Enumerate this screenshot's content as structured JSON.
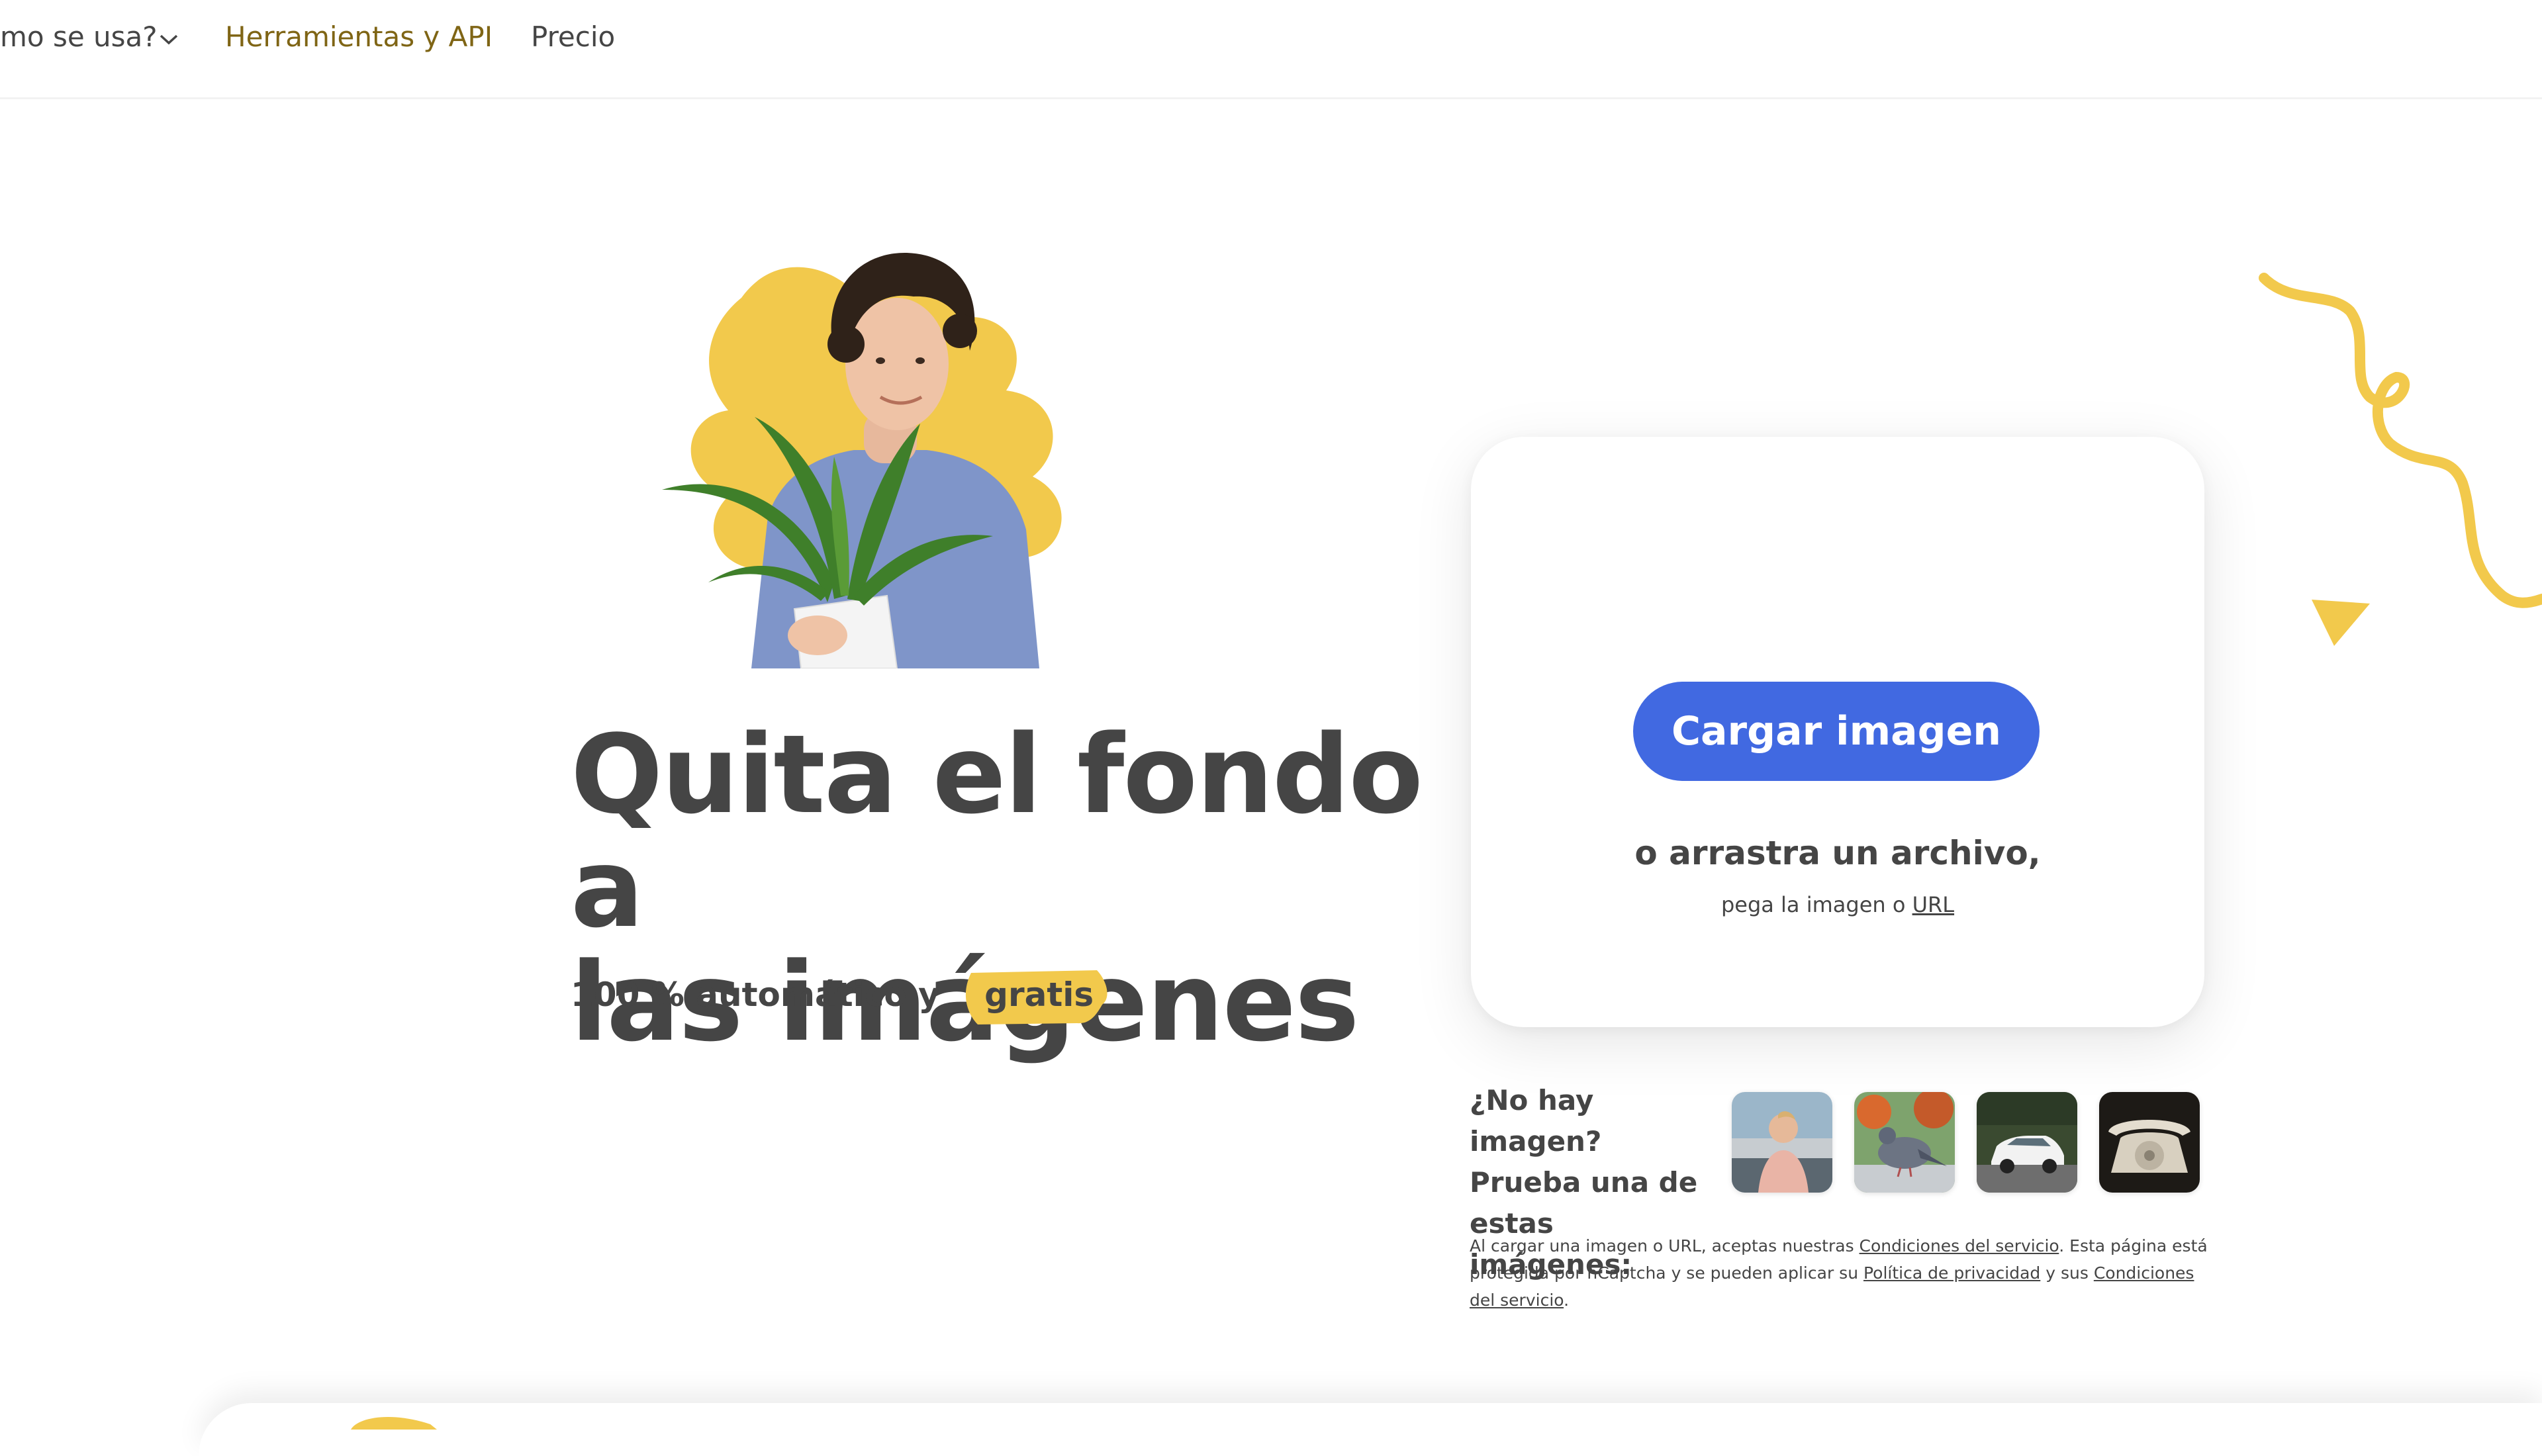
{
  "nav": {
    "how_label": "mo se usa?",
    "tools_label": "Herramientas y API",
    "price_label": "Precio"
  },
  "hero": {
    "title_line1": "Quita el fondo a",
    "title_line2": "las imágenes",
    "subtitle_prefix": "100 % automático y",
    "subtitle_highlight": "gratis"
  },
  "upload": {
    "button_label": "Cargar imagen",
    "drop_text": "o arrastra un archivo,",
    "paste_prefix": "pega la imagen o",
    "paste_link": "URL"
  },
  "samples": {
    "label_line1": "¿No hay imagen?",
    "label_line2": "Prueba una de",
    "label_line3": "estas imágenes:",
    "items": [
      {
        "icon": "person-photo"
      },
      {
        "icon": "pigeon-photo"
      },
      {
        "icon": "car-photo"
      },
      {
        "icon": "telephone-photo"
      }
    ]
  },
  "legal": {
    "part1": "Al cargar una imagen o URL, aceptas nuestras ",
    "link_terms": "Condiciones del servicio",
    "part2": ". Esta página está protegida por hCaptcha y se pueden aplicar su ",
    "link_privacy": "Política de privacidad",
    "part3": " y sus ",
    "link_terms2": "Condiciones del servicio",
    "part4": "."
  },
  "colors": {
    "accent_blue": "#4169e1",
    "accent_yellow": "#f2c94c",
    "text": "#454545",
    "nav_active": "#7f6515"
  }
}
